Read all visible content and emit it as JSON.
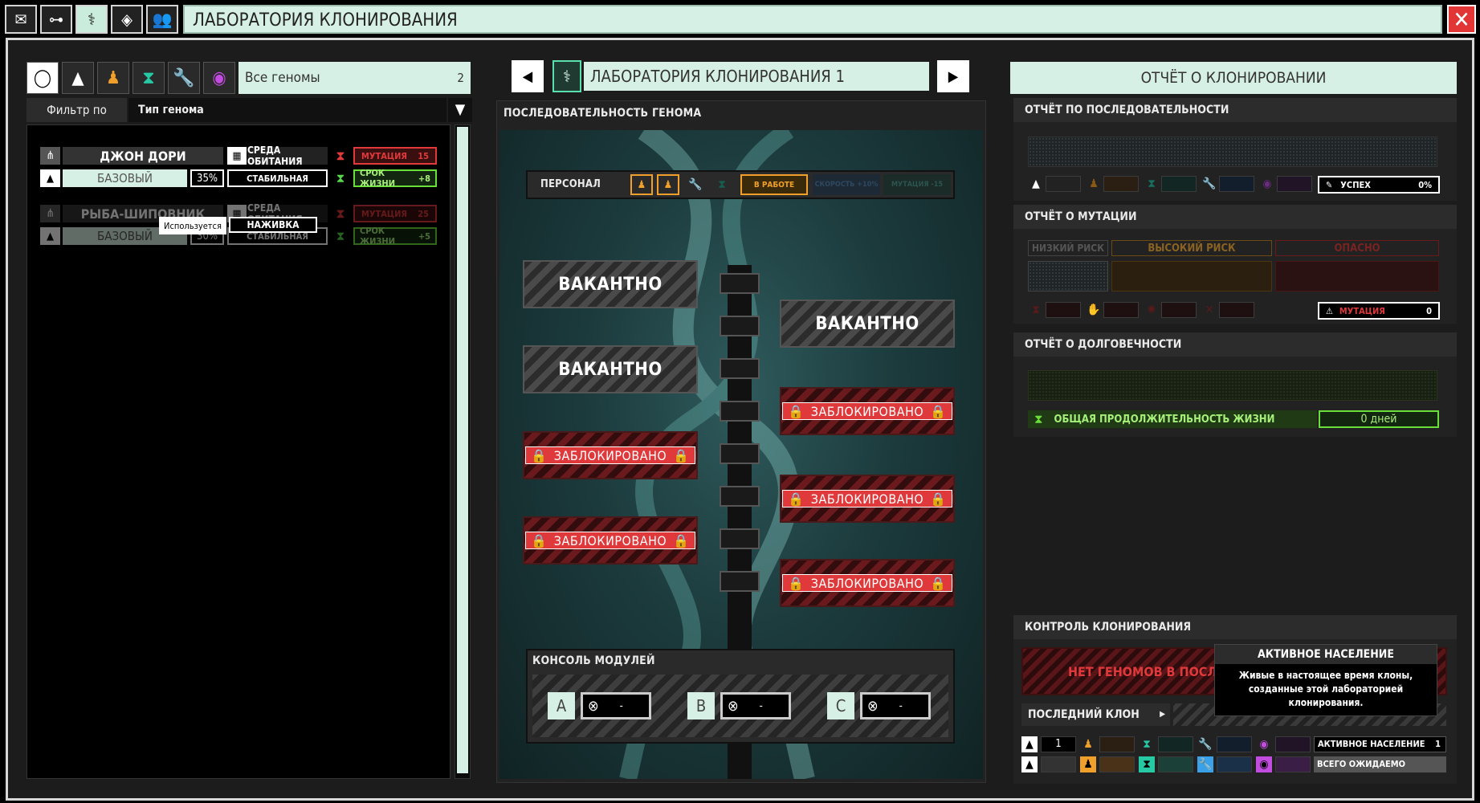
{
  "window": {
    "title": "ЛАБОРАТОРИЯ КЛОНИРОВАНИЯ",
    "close_label": "✕"
  },
  "toolbar": {
    "icons": [
      "mail-icon",
      "network-icon",
      "dna-icon",
      "target-icon",
      "group-icon"
    ]
  },
  "left": {
    "filter_title": "Все геномы",
    "filter_count": "2",
    "filter_by_label": "Фильтр по",
    "filter_by_value": "Тип генома",
    "genomes": [
      {
        "name": "ДЖОН ДОРИ",
        "type": "БАЗОВЫЙ",
        "percent": "35%",
        "habitat_label": "СРЕДА ОБИТАНИЯ",
        "habitat_value": "СТАБИЛЬНАЯ",
        "mutation_label": "МУТАЦИЯ",
        "mutation_value": "15",
        "lifespan_label": "СРОК ЖИЗНИ",
        "lifespan_value": "+8"
      },
      {
        "name": "РЫБА-ШИПОВНИК",
        "type": "БАЗОВЫЙ",
        "percent": "30%",
        "habitat_label": "СРЕДА ОБИТАНИЯ",
        "habitat_value": "СТАБИЛЬНАЯ",
        "mutation_label": "МУТАЦИЯ",
        "mutation_value": "25",
        "lifespan_label": "СРОК ЖИЗНИ",
        "lifespan_value": "+5",
        "tooltip": "Используется",
        "tag": "НАЖИВКА"
      }
    ]
  },
  "middle": {
    "lab_name": "ЛАБОРАТОРИЯ КЛОНИРОВАНИЯ 1",
    "sequence_title": "ПОСЛЕДОВАТЕЛЬНОСТЬ ГЕНОМА",
    "staff_label": "ПЕРСОНАЛ",
    "status_working": "В РАБОТЕ",
    "speed_label": "СКОРОСТЬ +10%",
    "mutation_label": "МУТАЦИЯ -15",
    "vacant": "ВАКАНТНО",
    "locked": "ЗАБЛОКИРОВАНО",
    "modules_title": "КОНСОЛЬ МОДУЛЕЙ",
    "modules": [
      {
        "letter": "A",
        "value": "-"
      },
      {
        "letter": "B",
        "value": "-"
      },
      {
        "letter": "C",
        "value": "-"
      }
    ]
  },
  "right": {
    "report_title": "ОТЧЁТ О КЛОНИРОВАНИИ",
    "sequence_report": "ОТЧЁТ ПО ПОСЛЕДОВАТЕЛЬНОСТИ",
    "success_label": "УСПЕХ",
    "success_value": "0%",
    "mutation_report": "ОТЧЁТ О МУТАЦИИ",
    "risk_low": "НИЗКИЙ РИСК",
    "risk_high": "ВЫСОКИЙ РИСК",
    "risk_danger": "ОПАСНО",
    "mutation_total_label": "МУТАЦИЯ",
    "mutation_total_value": "0",
    "longevity_report": "ОТЧЁТ О ДОЛГОВЕЧНОСТИ",
    "lifespan_total_label": "ОБЩАЯ ПРОДОЛЖИТЕЛЬНОСТЬ ЖИЗНИ",
    "lifespan_total_value": "0 дней",
    "control_title": "КОНТРОЛЬ КЛОНИРОВАНИЯ",
    "no_genomes": "НЕТ ГЕНОМОВ В ПОСЛЕДО",
    "last_clone": "ПОСЛЕДНИЙ КЛОН",
    "active_pop_label": "АКТИВНОЕ НАСЕЛЕНИЕ",
    "active_pop_value": "1",
    "expected_label": "ВСЕГО ОЖИДАЕМО",
    "stat_value_1": "1",
    "tooltip_title": "АКТИВНОЕ НАСЕЛЕНИЕ",
    "tooltip_text": "Живые в настоящее время клоны, созданные этой лабораторией клонирования."
  }
}
